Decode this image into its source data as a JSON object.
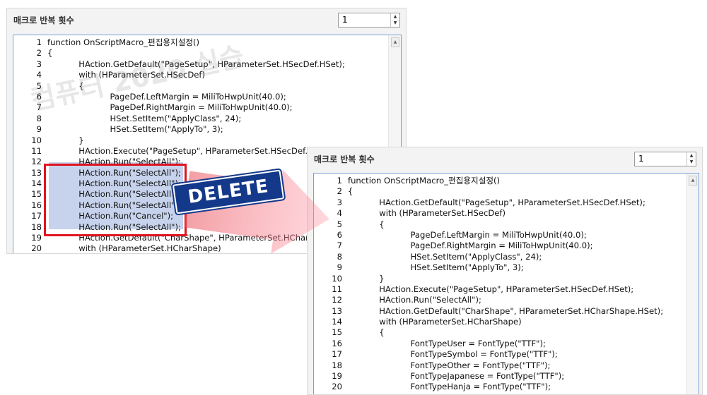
{
  "left_panel": {
    "title": "매크로 반복 횟수",
    "repeat_value": "1",
    "lines": [
      {
        "n": "1",
        "t": "function OnScriptMacro_편집용지설정()"
      },
      {
        "n": "2",
        "t": "{"
      },
      {
        "n": "3",
        "t": "            HAction.GetDefault(\"PageSetup\", HParameterSet.HSecDef.HSet);"
      },
      {
        "n": "4",
        "t": "            with (HParameterSet.HSecDef)"
      },
      {
        "n": "5",
        "t": "            {"
      },
      {
        "n": "6",
        "t": "                        PageDef.LeftMargin = MiliToHwpUnit(40.0);"
      },
      {
        "n": "7",
        "t": "                        PageDef.RightMargin = MiliToHwpUnit(40.0);"
      },
      {
        "n": "8",
        "t": "                        HSet.SetItem(\"ApplyClass\", 24);"
      },
      {
        "n": "9",
        "t": "                        HSet.SetItem(\"ApplyTo\", 3);"
      },
      {
        "n": "10",
        "t": "            }"
      },
      {
        "n": "11",
        "t": "            HAction.Execute(\"PageSetup\", HParameterSet.HSecDef.HSet);"
      },
      {
        "n": "12",
        "t": "            HAction.Run(\"SelectAll\");"
      },
      {
        "n": "13",
        "t": "            HAction.Run(\"SelectAll\");"
      },
      {
        "n": "14",
        "t": "            HAction.Run(\"SelectAll\");"
      },
      {
        "n": "15",
        "t": "            HAction.Run(\"SelectAll\");"
      },
      {
        "n": "16",
        "t": "            HAction.Run(\"SelectAll\");"
      },
      {
        "n": "17",
        "t": "            HAction.Run(\"Cancel\");"
      },
      {
        "n": "18",
        "t": "            HAction.Run(\"SelectAll\");"
      },
      {
        "n": "19",
        "t": "            HAction.GetDefault(\"CharShape\", HParameterSet.HCharShape.HSet);"
      },
      {
        "n": "20",
        "t": "            with (HParameterSet.HCharShape)"
      }
    ]
  },
  "right_panel": {
    "title": "매크로 반복 횟수",
    "repeat_value": "1",
    "lines": [
      {
        "n": "1",
        "t": "function OnScriptMacro_편집용지설정()"
      },
      {
        "n": "2",
        "t": "{"
      },
      {
        "n": "3",
        "t": "            HAction.GetDefault(\"PageSetup\", HParameterSet.HSecDef.HSet);"
      },
      {
        "n": "4",
        "t": "            with (HParameterSet.HSecDef)"
      },
      {
        "n": "5",
        "t": "            {"
      },
      {
        "n": "6",
        "t": "                        PageDef.LeftMargin = MiliToHwpUnit(40.0);"
      },
      {
        "n": "7",
        "t": "                        PageDef.RightMargin = MiliToHwpUnit(40.0);"
      },
      {
        "n": "8",
        "t": "                        HSet.SetItem(\"ApplyClass\", 24);"
      },
      {
        "n": "9",
        "t": "                        HSet.SetItem(\"ApplyTo\", 3);"
      },
      {
        "n": "10",
        "t": "            }"
      },
      {
        "n": "11",
        "t": "            HAction.Execute(\"PageSetup\", HParameterSet.HSecDef.HSet);"
      },
      {
        "n": "12",
        "t": "            HAction.Run(\"SelectAll\");"
      },
      {
        "n": "13",
        "t": "            HAction.GetDefault(\"CharShape\", HParameterSet.HCharShape.HSet);"
      },
      {
        "n": "14",
        "t": "            with (HParameterSet.HCharShape)"
      },
      {
        "n": "15",
        "t": "            {"
      },
      {
        "n": "16",
        "t": "                        FontTypeUser = FontType(\"TTF\");"
      },
      {
        "n": "17",
        "t": "                        FontTypeSymbol = FontType(\"TTF\");"
      },
      {
        "n": "18",
        "t": "                        FontTypeOther = FontType(\"TTF\");"
      },
      {
        "n": "19",
        "t": "                        FontTypeJapanese = FontType(\"TTF\");"
      },
      {
        "n": "20",
        "t": "                        FontTypeHanja = FontType(\"TTF\");"
      }
    ]
  },
  "overlay": {
    "delete_label": "DELETE",
    "watermark": "컴퓨터 2020 실습"
  },
  "colors": {
    "selection": "#c7d3ec",
    "highlight_border": "#e0141e",
    "badge": "#14398a",
    "editor_border": "#7a9fd4"
  }
}
